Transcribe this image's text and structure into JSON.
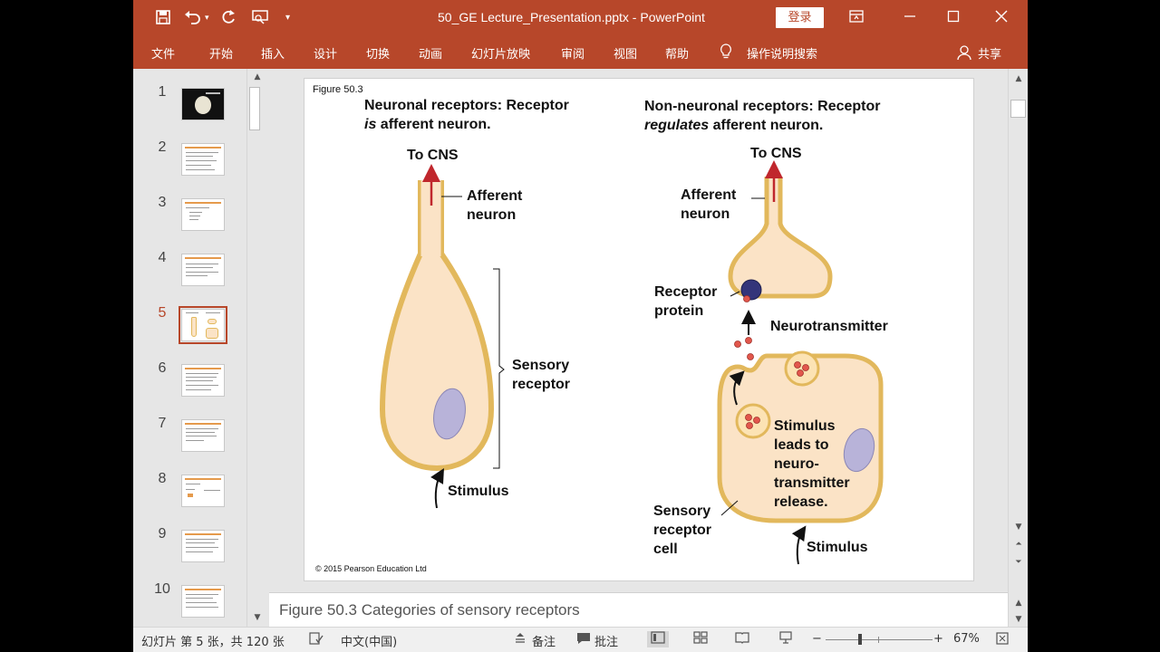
{
  "titlebar": {
    "doc_title": "50_GE Lecture_Presentation.pptx  -  PowerPoint",
    "login": "登录",
    "save_icon": "floppy-icon",
    "undo_icon": "undo-icon",
    "redo_icon": "redo-icon",
    "present_icon": "slideshow-icon",
    "customize_icon": "customize-icon"
  },
  "ribbon": {
    "tabs": [
      "文件",
      "开始",
      "插入",
      "设计",
      "切换",
      "动画",
      "幻灯片放映",
      "审阅",
      "视图",
      "帮助"
    ],
    "search_label": "操作说明搜索",
    "share_label": "共享"
  },
  "thumbnails": {
    "numbers": [
      "1",
      "2",
      "3",
      "4",
      "5",
      "6",
      "7",
      "8",
      "9",
      "10"
    ],
    "selected": 5
  },
  "slide": {
    "fig_label": "Figure 50.3",
    "left_title_1": "Neuronal receptors: Receptor",
    "left_title_2_it": "is",
    "left_title_2_rest": " afferent neuron.",
    "right_title_1": "Non-neuronal receptors: Receptor",
    "right_title_2_it": "regulates",
    "right_title_2_rest": " afferent neuron.",
    "to_cns_left": "To CNS",
    "to_cns_right": "To CNS",
    "afferent_left_1": "Afferent",
    "afferent_left_2": "neuron",
    "afferent_right_1": "Afferent",
    "afferent_right_2": "neuron",
    "sensory_receptor_1": "Sensory",
    "sensory_receptor_2": "receptor",
    "stimulus_left": "Stimulus",
    "receptor_protein_1": "Receptor",
    "receptor_protein_2": "protein",
    "neurotransmitter": "Neurotransmitter",
    "stim_leads": [
      "Stimulus",
      "leads to",
      "neuro-",
      "transmitter",
      "release."
    ],
    "sensory_cell": [
      "Sensory",
      "receptor",
      "cell"
    ],
    "stimulus_right": "Stimulus",
    "copyright": "© 2015 Pearson Education Ltd",
    "colors": {
      "cell_fill": "#fbe3c6",
      "cell_edge": "#e2b85c",
      "nucleus": "#b8b3d9",
      "arrow": "#c0272d",
      "protein": "#34357a"
    }
  },
  "notes": {
    "text": "Figure 50.3 Categories of sensory receptors"
  },
  "status": {
    "slide_info": "幻灯片 第 5 张，共 120 张",
    "language": "中文(中国)",
    "notes_btn": "备注",
    "comments_btn": "批注",
    "zoom": "67%"
  }
}
